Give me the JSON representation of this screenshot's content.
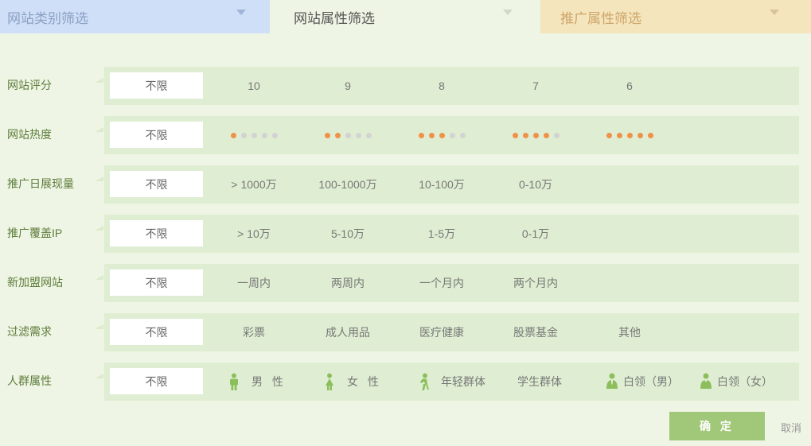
{
  "tabs": [
    {
      "label": "网站类别筛选"
    },
    {
      "label": "网站属性筛选"
    },
    {
      "label": "推广属性筛选"
    }
  ],
  "rows": [
    {
      "label": "网站评分",
      "all": "不限",
      "options": [
        "10",
        "9",
        "8",
        "7",
        "6"
      ]
    },
    {
      "label": "网站热度",
      "all": "不限",
      "heat_levels": [
        1,
        2,
        3,
        4,
        5
      ]
    },
    {
      "label": "推广日展现量",
      "all": "不限",
      "options": [
        "> 1000万",
        "100-1000万",
        "10-100万",
        "0-10万"
      ]
    },
    {
      "label": "推广覆盖IP",
      "all": "不限",
      "options": [
        "> 10万",
        "5-10万",
        "1-5万",
        "0-1万"
      ]
    },
    {
      "label": "新加盟网站",
      "all": "不限",
      "options": [
        "一周内",
        "两周内",
        "一个月内",
        "两个月内"
      ]
    },
    {
      "label": "过滤需求",
      "all": "不限",
      "options": [
        "彩票",
        "成人用品",
        "医疗健康",
        "股票基金",
        "其他"
      ]
    },
    {
      "label": "人群属性",
      "all": "不限",
      "audience": [
        {
          "label": "男 性",
          "icon": "man-icon"
        },
        {
          "label": "女 性",
          "icon": "woman-icon"
        },
        {
          "label": "年轻群体",
          "icon": "young-person-icon"
        },
        {
          "label": "学生群体",
          "icon": ""
        },
        {
          "label": "白领（男）",
          "icon": "office-man-icon"
        },
        {
          "label": "白领（女）",
          "icon": "office-woman-icon"
        }
      ]
    }
  ],
  "actions": {
    "confirm": "确 定",
    "cancel": "取消"
  },
  "colors": {
    "accent": "#a0c878",
    "heat_on": "#f0914a",
    "heat_off": "#d3d3d3",
    "icon": "#8cbf5c"
  }
}
